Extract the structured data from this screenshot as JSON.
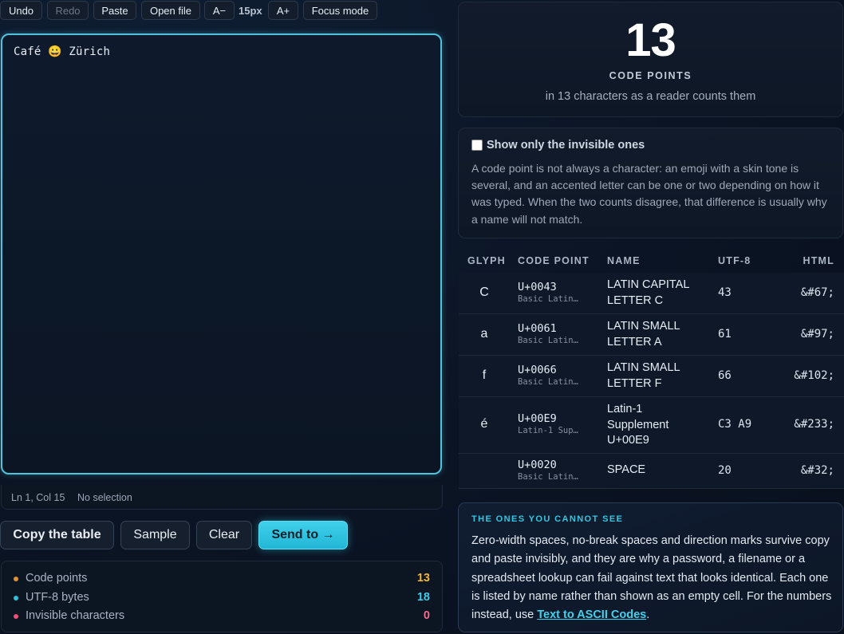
{
  "toolbar": {
    "undo": "Undo",
    "redo": "Redo",
    "paste": "Paste",
    "open_file": "Open file",
    "font_decrease": "A−",
    "font_size": "15px",
    "font_increase": "A+",
    "focus_mode": "Focus mode"
  },
  "editor": {
    "text": "Café 😀 Zürich"
  },
  "statusbar": {
    "position": "Ln 1, Col 15",
    "selection": "No selection"
  },
  "actions": {
    "copy_table": "Copy the table",
    "sample": "Sample",
    "clear": "Clear",
    "send_to": "Send to →"
  },
  "stats": [
    {
      "label": "Code points",
      "value": "13",
      "color": "#e0922f"
    },
    {
      "label": "UTF-8 bytes",
      "value": "18",
      "color": "#2fc0dc"
    },
    {
      "label": "Invisible characters",
      "value": "0",
      "color": "#ee4f78"
    }
  ],
  "summary": {
    "count": "13",
    "label": "CODE POINTS",
    "sub": "in 13 characters as a reader counts them"
  },
  "filter": {
    "checkbox_label": "Show only the invisible ones",
    "note": "A code point is not always a character: an emoji with a skin tone is several, and an accented letter can be one or two depending on how it was typed. When the two counts disagree, that difference is usually why a name will not match."
  },
  "table": {
    "headers": [
      "GLYPH",
      "CODE POINT",
      "NAME",
      "UTF-8",
      "HTML"
    ],
    "rows": [
      {
        "glyph": "C",
        "cp": "U+0043",
        "block": "Basic Latin…",
        "name": "LATIN CAPITAL LETTER C",
        "utf8": "43",
        "html": "&#67;"
      },
      {
        "glyph": "a",
        "cp": "U+0061",
        "block": "Basic Latin…",
        "name": "LATIN SMALL LETTER A",
        "utf8": "61",
        "html": "&#97;"
      },
      {
        "glyph": "f",
        "cp": "U+0066",
        "block": "Basic Latin…",
        "name": "LATIN SMALL LETTER F",
        "utf8": "66",
        "html": "&#102;"
      },
      {
        "glyph": "é",
        "cp": "U+00E9",
        "block": "Latin-1 Sup…",
        "name": "Latin-1 Supplement U+00E9",
        "utf8": "C3 A9",
        "html": "&#233;"
      },
      {
        "glyph": "",
        "cp": "U+0020",
        "block": "Basic Latin…",
        "name": "SPACE",
        "utf8": "20",
        "html": "&#32;"
      }
    ]
  },
  "info": {
    "title": "THE ONES YOU CANNOT SEE",
    "body": "Zero-width spaces, no-break spaces and direction marks survive copy and paste invisibly, and they are why a password, a filename or a spreadsheet lookup can fail against text that looks identical. Each one is listed by name rather than shown as an empty cell. For the numbers instead, use ",
    "link": "Text to ASCII Codes",
    "tail": "."
  }
}
